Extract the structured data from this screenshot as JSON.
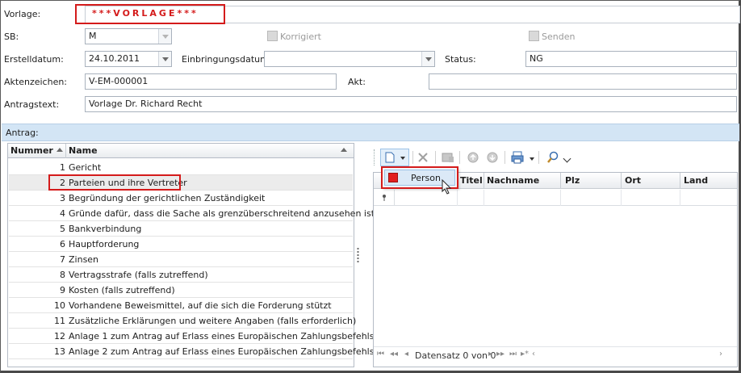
{
  "header": {
    "vorlage_label": "Vorlage:",
    "vorlage_value": "***VORLAGE***",
    "sb_label": "SB:",
    "sb_value": "M",
    "korrigiert_label": "Korrigiert",
    "senden_label": "Senden",
    "erstelldatum_label": "Erstelldatum:",
    "erstelldatum_value": "24.10.2011",
    "einbringungsdatum_label": "Einbringungsdatum:",
    "einbringungsdatum_value": "",
    "status_label": "Status:",
    "status_value": "NG",
    "aktenzeichen_label": "Aktenzeichen:",
    "aktenzeichen_value": "V-EM-000001",
    "akt_label": "Akt:",
    "akt_value": "",
    "antragstext_label": "Antragstext:",
    "antragstext_value": "Vorlage Dr. Richard Recht"
  },
  "antrag": {
    "section_label": "Antrag:",
    "columns": {
      "nummer": "Nummer",
      "name": "Name"
    },
    "rows": [
      {
        "num": "1",
        "name": "Gericht"
      },
      {
        "num": "2",
        "name": "Parteien und ihre Vertreter"
      },
      {
        "num": "3",
        "name": "Begründung der gerichtlichen Zuständigkeit"
      },
      {
        "num": "4",
        "name": "Gründe dafür, dass die Sache als grenzüberschreitend anzusehen ist"
      },
      {
        "num": "5",
        "name": "Bankverbindung"
      },
      {
        "num": "6",
        "name": "Hauptforderung"
      },
      {
        "num": "7",
        "name": "Zinsen"
      },
      {
        "num": "8",
        "name": "Vertragsstrafe (falls zutreffend)"
      },
      {
        "num": "9",
        "name": "Kosten (falls zutreffend)"
      },
      {
        "num": "10",
        "name": "Vorhandene Beweismittel, auf die sich die Forderung stützt"
      },
      {
        "num": "11",
        "name": "Zusätzliche Erklärungen und weitere Angaben (falls erforderlich)"
      },
      {
        "num": "12",
        "name": "Anlage 1 zum Antrag auf Erlass eines Europäischen Zahlungsbefehls"
      },
      {
        "num": "13",
        "name": "Anlage 2 zum Antrag auf Erlass eines Europäischen Zahlungsbefehls"
      }
    ]
  },
  "parties": {
    "popup_item": "Person",
    "columns": {
      "titel": "Titel",
      "nachname": "Nachname",
      "plz": "Plz",
      "ort": "Ort",
      "land": "Land"
    },
    "navigator_text": "Datensatz 0 von 0"
  },
  "colors": {
    "highlight_red": "#d41b1b",
    "section_blue": "#d3e5f5"
  }
}
